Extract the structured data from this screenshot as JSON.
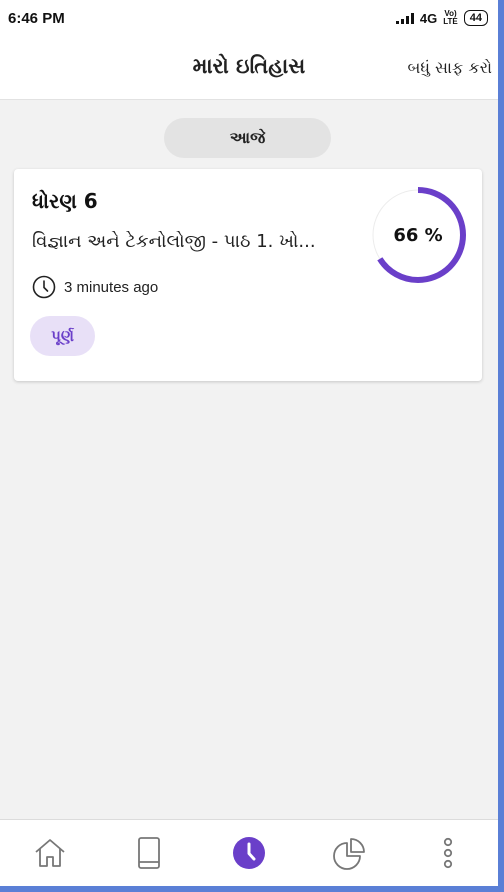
{
  "status_bar": {
    "time": "6:46 PM",
    "network": "4G",
    "volte_top": "Vo)",
    "volte_bottom": "LTE",
    "battery": "44"
  },
  "header": {
    "title": "મારો ઇતિહાસ",
    "clear_all_label": "બધું સાફ કરો"
  },
  "section": {
    "label": "આજે"
  },
  "history_items": [
    {
      "title": "ધોરણ 6",
      "subtitle": "વિજ્ઞાન અને ટેકનોલોજી - પાઠ 1. ખો...",
      "time": "3 minutes ago",
      "status": "પૂર્ણ",
      "progress_text": "66 %",
      "progress": 0.66
    }
  ],
  "colors": {
    "accent": "#6a3fc9",
    "badge_bg": "#e8e0f7",
    "frame": "#5a7fd6"
  },
  "bottom_nav": {
    "items": [
      "home-icon",
      "book-icon",
      "clock-icon",
      "chart-pie-icon",
      "more-icon"
    ],
    "active": "clock-icon"
  }
}
